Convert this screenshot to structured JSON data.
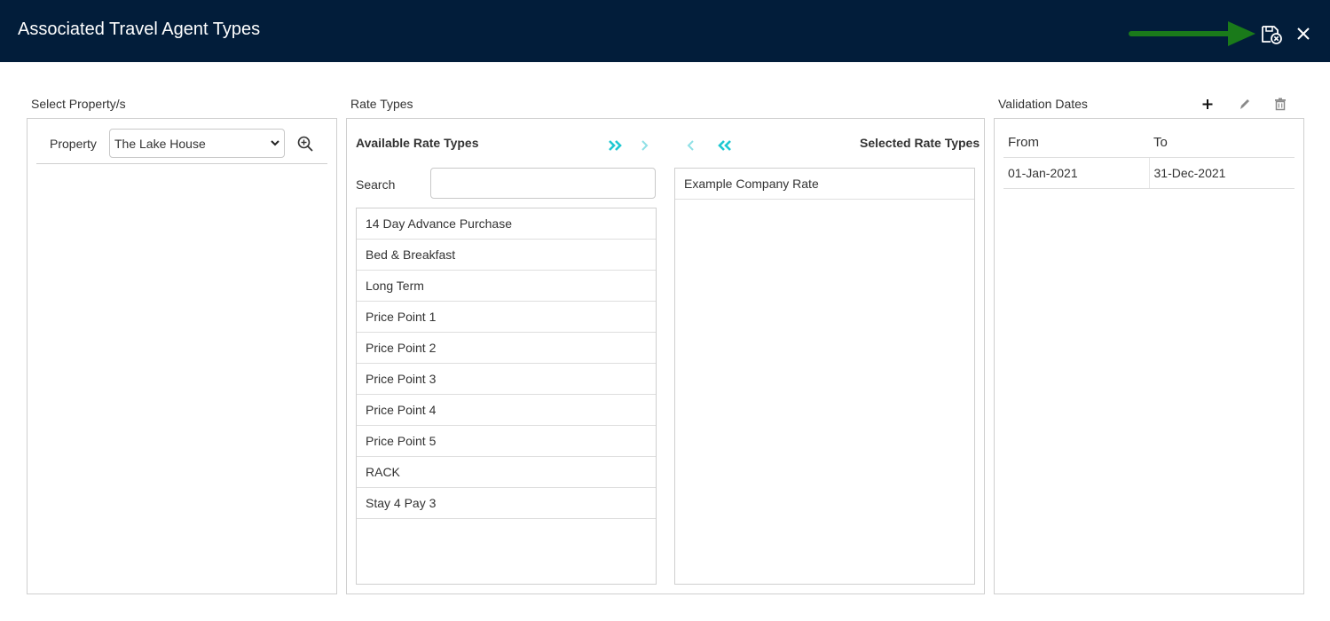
{
  "window": {
    "title": "Associated Travel Agent Types"
  },
  "property_panel": {
    "section_label": "Select Property/s",
    "property_label": "Property",
    "selected_property": "The Lake House"
  },
  "rate_types": {
    "section_label": "Rate Types",
    "available_title": "Available Rate Types",
    "selected_title": "Selected Rate Types",
    "search_label": "Search",
    "search_value": "",
    "available": [
      "14 Day Advance Purchase",
      "Bed & Breakfast",
      "Long Term",
      "Price Point 1",
      "Price Point 2",
      "Price Point 3",
      "Price Point 4",
      "Price Point 5",
      "RACK",
      "Stay 4 Pay 3"
    ],
    "selected": [
      "Example Company Rate"
    ]
  },
  "validation_dates": {
    "section_label": "Validation Dates",
    "columns": [
      "From",
      "To"
    ],
    "rows": [
      [
        "01-Jan-2021",
        "31-Dec-2021"
      ]
    ]
  },
  "colors": {
    "header_bg": "#021d3a",
    "accent_teal": "#1ec8d2",
    "arrow_green": "#1a7a1a"
  },
  "icons": {
    "save": "save-with-cancel-icon",
    "close": "close-icon",
    "zoom": "zoom-in-icon",
    "move_all_right": "double-chevron-right-icon",
    "move_right": "chevron-right-icon",
    "move_left": "chevron-left-icon",
    "move_all_left": "double-chevron-left-icon",
    "add": "plus-icon",
    "edit": "pencil-icon",
    "delete": "trash-icon"
  }
}
